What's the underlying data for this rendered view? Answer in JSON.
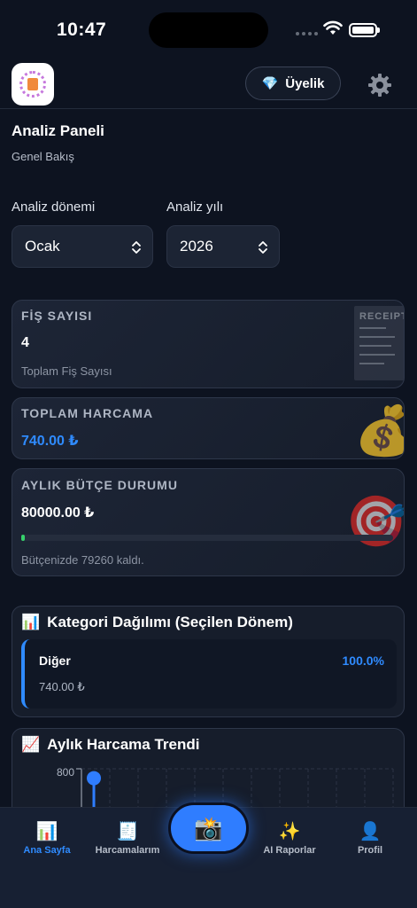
{
  "status": {
    "time": "10:47"
  },
  "header": {
    "membership_label": "Üyelik",
    "membership_icon": "💎"
  },
  "page": {
    "title": "Analiz Paneli",
    "subtitle": "Genel Bakış"
  },
  "filters": {
    "period_label": "Analiz dönemi",
    "period_value": "Ocak",
    "year_label": "Analiz yılı",
    "year_value": "2026"
  },
  "cards": {
    "receipts": {
      "title": "FİŞ SAYISI",
      "value": "4",
      "note": "Toplam Fiş Sayısı",
      "image_text": "RECEIPT"
    },
    "total": {
      "title": "TOPLAM HARCAMA",
      "value": "740.00 ₺",
      "icon": "💰"
    },
    "budget": {
      "title": "AYLIK BÜTÇE DURUMU",
      "value": "80000.00 ₺",
      "note": "Bütçenizde 79260 kaldı.",
      "progress_fraction": 0.009,
      "icon": "🎯"
    }
  },
  "category_section": {
    "icon": "📊",
    "title": "Kategori Dağılımı (Seçilen Dönem)",
    "items": [
      {
        "name": "Diğer",
        "percent": "100.0%",
        "amount": "740.00 ₺"
      }
    ]
  },
  "trend_section": {
    "icon": "📈",
    "title": "Aylık Harcama Trendi"
  },
  "chart_data": {
    "type": "line",
    "title": "Aylık Harcama Trendi",
    "yticks": [
      "800"
    ],
    "series": [
      {
        "values": [
          740
        ]
      }
    ]
  },
  "tabbar": {
    "tabs": [
      {
        "label": "Ana Sayfa",
        "icon": "📊"
      },
      {
        "label": "Harcamalarım",
        "icon": "🧾"
      },
      {
        "label": "AI Raporlar",
        "icon": "✨"
      },
      {
        "label": "Profil",
        "icon": "👤"
      }
    ],
    "camera_icon": "📸"
  },
  "colors": {
    "accent": "#2f8bff",
    "background": "#0d1320",
    "progress": "#36d06b"
  }
}
